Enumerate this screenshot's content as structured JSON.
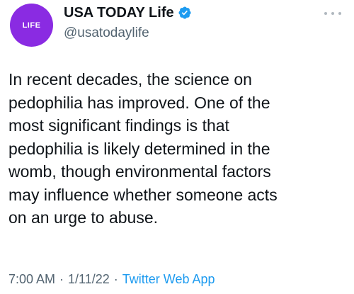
{
  "tweet": {
    "avatar_text": "LIFE",
    "display_name": "USA TODAY Life",
    "handle": "@usatodaylife",
    "text": "In recent decades, the science on\npedophilia has improved. One of the\nmost significant findings is that\npedophilia is likely determined in the\nwomb, though environmental factors\nmay influence whether someone acts\non an urge to abuse.",
    "time": "7:00 AM",
    "date": "1/11/22",
    "separator": "·",
    "source_app": "Twitter Web App"
  },
  "colors": {
    "avatar_bg": "#8a2be2",
    "verified_badge": "#1d9bf0",
    "link": "#1d9bf0",
    "secondary_text": "#536471"
  },
  "icons": {
    "verified": "verified-badge-icon",
    "more": "more-options-icon"
  }
}
